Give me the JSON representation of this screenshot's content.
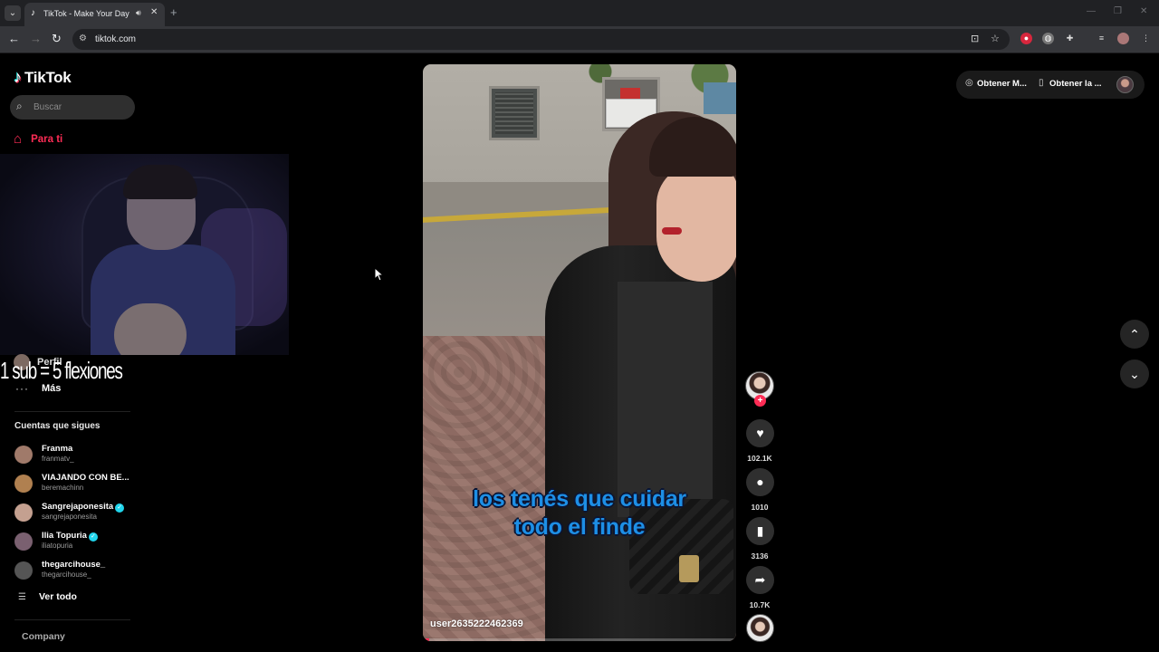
{
  "browser": {
    "tab_title": "TikTok - Make Your Day",
    "url": "tikto​k.com"
  },
  "sidebar": {
    "logo_text": "TikTok",
    "search_placeholder": "Buscar",
    "nav_home": "Para ti",
    "nav_profile": "Perfil",
    "nav_more": "Más",
    "following_heading": "Cuentas que sigues",
    "accounts": [
      {
        "name": "Franma",
        "user": "franmatv_",
        "verified": false,
        "color": "#a07a6a"
      },
      {
        "name": "VIAJANDO CON BE...",
        "user": "beremachinn",
        "verified": false,
        "color": "#b08050"
      },
      {
        "name": "Sangrejaponesita",
        "user": "sangrejaponesita",
        "verified": true,
        "color": "#c4a090"
      },
      {
        "name": "Ilia Topuria",
        "user": "iliatopuria",
        "verified": true,
        "color": "#7a6070"
      },
      {
        "name": "thegarcihouse_",
        "user": "thegarcihouse_",
        "verified": false,
        "color": "#555555"
      }
    ],
    "see_all": "Ver todo",
    "company": "Company"
  },
  "stream_overlay": {
    "text": "1 sub = 5 flexiones"
  },
  "video": {
    "caption_line1": "los tenés que cuidar",
    "caption_line2": "todo el finde",
    "author": "user2635222462369",
    "progress_fraction": 0.02
  },
  "actions": {
    "likes": "102.1K",
    "comments": "1010",
    "saves": "3136",
    "shares": "10.7K"
  },
  "topbar": {
    "get_coins": "Obtener M...",
    "get_app": "Obtener la ..."
  },
  "colors": {
    "brand": "#fe2c55",
    "caption": "#1d8fe6",
    "verified": "#20d5ec"
  }
}
